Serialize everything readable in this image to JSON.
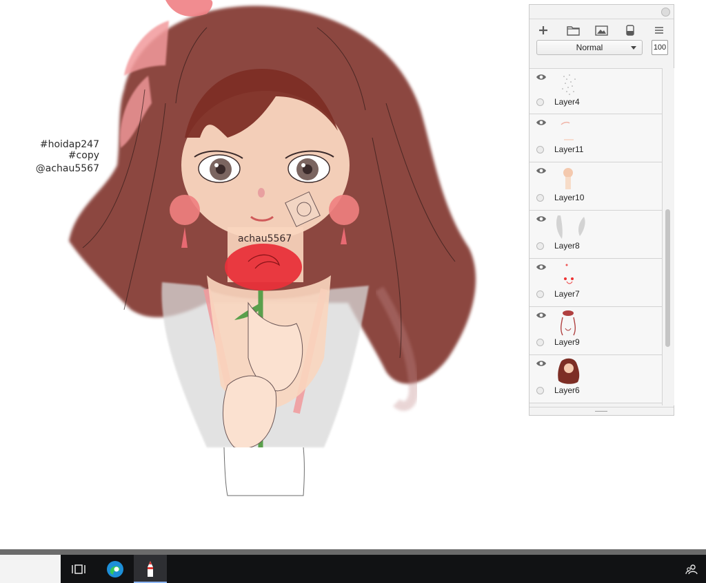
{
  "canvas": {
    "watermark_tag1": "#hoidap247",
    "watermark_tag2": "#copy",
    "watermark_user": "@achau5567",
    "watermark_center": "achau5567"
  },
  "layer_panel": {
    "toolbar_icons": [
      "add-layer-icon",
      "folder-icon",
      "image-icon",
      "eraser-icon",
      "menu-icon"
    ],
    "blend_mode": "Normal",
    "opacity": "100",
    "layers": [
      {
        "name": "Layer4",
        "visible": true
      },
      {
        "name": "Layer11",
        "visible": true
      },
      {
        "name": "Layer10",
        "visible": true
      },
      {
        "name": "Layer8",
        "visible": true
      },
      {
        "name": "Layer7",
        "visible": true
      },
      {
        "name": "Layer9",
        "visible": true
      },
      {
        "name": "Layer6",
        "visible": true
      }
    ]
  },
  "taskbar": {
    "icons": [
      "task-view-icon",
      "edge-icon",
      "paint-app-icon",
      "people-icon"
    ]
  },
  "colors": {
    "hair": "#7d2e25",
    "skin": "#f9d6bf",
    "rose": "#e8323a",
    "ribbon": "#f29a9c",
    "dress": "#d9d9d9",
    "panel_bg": "#f3f3f3",
    "taskbar": "#111214"
  }
}
